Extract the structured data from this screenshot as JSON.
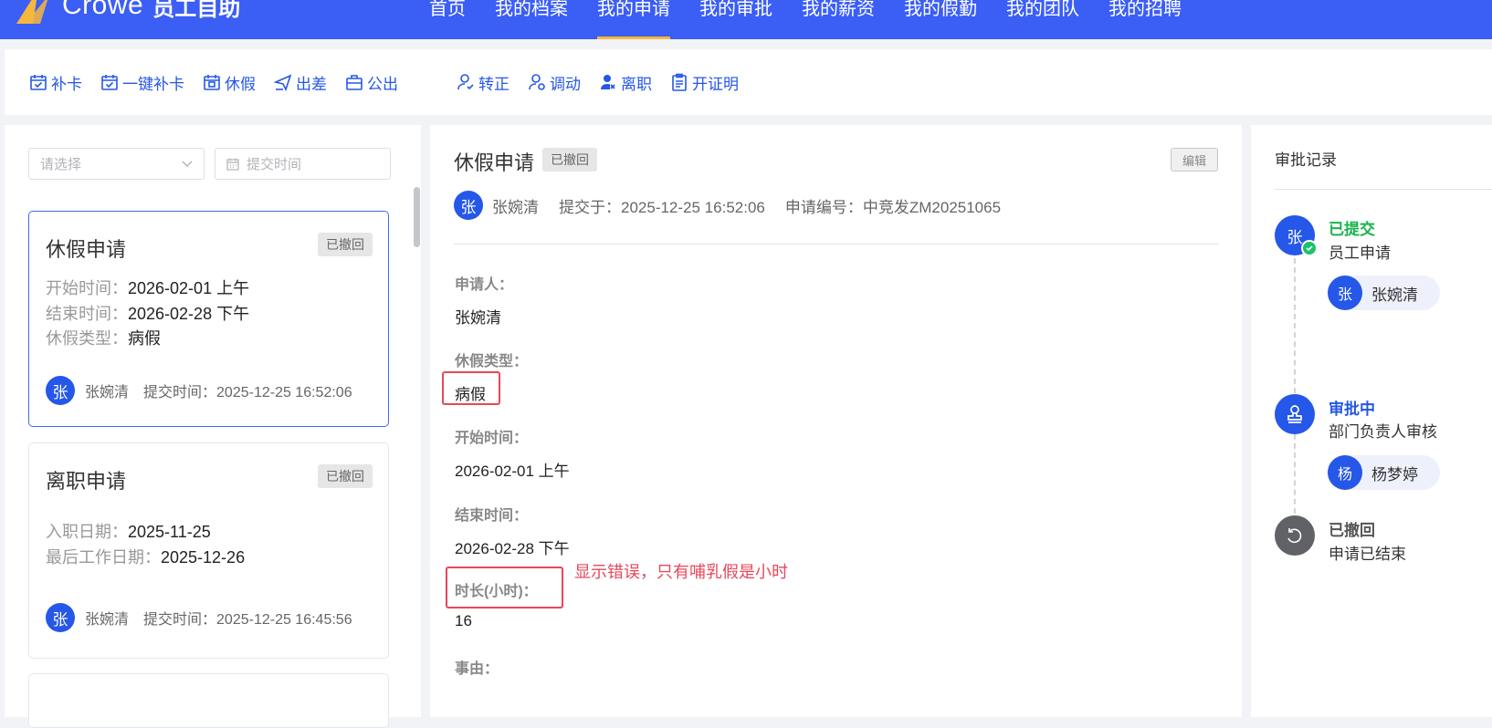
{
  "header": {
    "brand": "Crowe",
    "product": "员工自助",
    "nav": [
      "首页",
      "我的档案",
      "我的申请",
      "我的审批",
      "我的薪资",
      "我的假勤",
      "我的团队",
      "我的招聘"
    ],
    "active_nav": "我的申请"
  },
  "toolbar": {
    "items": [
      "补卡",
      "一键补卡",
      "休假",
      "出差",
      "公出",
      "转正",
      "调动",
      "离职",
      "开证明"
    ]
  },
  "filters": {
    "type_placeholder": "请选择",
    "date_placeholder": "提交时间"
  },
  "list": {
    "cards": [
      {
        "title": "休假申请",
        "status": "已撤回",
        "fields": [
          {
            "k": "开始时间：",
            "v": "2026-02-01 上午"
          },
          {
            "k": "结束时间：",
            "v": "2026-02-28 下午"
          },
          {
            "k": "休假类型：",
            "v": "病假"
          }
        ],
        "avatar": "张",
        "name": "张婉清",
        "submit": "提交时间：2025-12-25 16:52:06"
      },
      {
        "title": "离职申请",
        "status": "已撤回",
        "fields": [
          {
            "k": "入职日期：",
            "v": "2025-11-25"
          },
          {
            "k": "最后工作日期：",
            "v": "2025-12-26"
          }
        ],
        "avatar": "张",
        "name": "张婉清",
        "submit": "提交时间：2025-12-25 16:45:56"
      }
    ]
  },
  "detail": {
    "title": "休假申请",
    "status": "已撤回",
    "edit": "编辑",
    "avatar": "张",
    "name": "张婉清",
    "submitted": "提交于：2025-12-25 16:52:06",
    "code": "申请编号：中竞发ZM20251065",
    "fields": [
      {
        "label": "申请人：",
        "value": "张婉清"
      },
      {
        "label": "休假类型：",
        "value": "病假"
      },
      {
        "label": "开始时间：",
        "value": "2026-02-01 上午"
      },
      {
        "label": "结束时间：",
        "value": "2026-02-28 下午"
      },
      {
        "label": "时长(小时)：",
        "value": "16"
      },
      {
        "label": "事由：",
        "value": ""
      }
    ],
    "annotation": "显示错误，只有哺乳假是小时",
    "annotation_color": "#e8475a"
  },
  "approval": {
    "title": "审批记录",
    "steps": [
      {
        "status": "已提交",
        "desc": "员工申请",
        "node": "张",
        "person_avatar": "张",
        "person": "张婉清",
        "color": "#19b34e"
      },
      {
        "status": "审批中",
        "desc": "部门负责人审核",
        "node_icon": "stamp-icon",
        "person_avatar": "杨",
        "person": "杨梦婷",
        "color": "#2557e8"
      },
      {
        "status": "已撤回",
        "desc": "申请已结束",
        "node_icon": "undo-icon",
        "color": "#555555"
      }
    ]
  },
  "colors": {
    "primary": "#3b5ef5",
    "accent": "#2557e8",
    "nav_underline": "#f6b73c"
  }
}
